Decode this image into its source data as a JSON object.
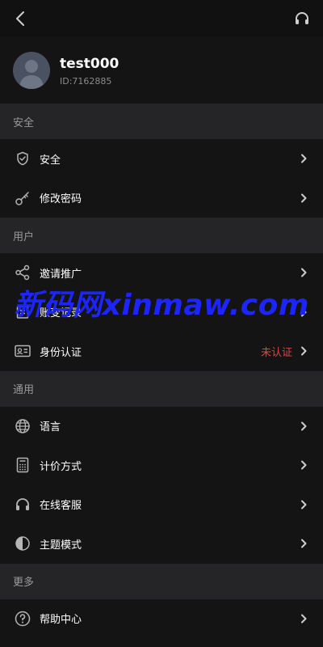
{
  "header": {
    "back_icon": "chevron-left-icon",
    "support_icon": "headset-icon"
  },
  "profile": {
    "username": "test000",
    "user_id": "ID:7162885"
  },
  "sections": {
    "security": {
      "title": "安全",
      "items": [
        {
          "label": "安全",
          "icon": "shield-check-icon"
        },
        {
          "label": "修改密码",
          "icon": "key-icon"
        }
      ]
    },
    "user": {
      "title": "用户",
      "items": [
        {
          "label": "邀请推广",
          "icon": "share-icon"
        },
        {
          "label": "账变记录",
          "icon": "document-icon"
        },
        {
          "label": "身份认证",
          "icon": "id-card-icon",
          "status": "未认证"
        }
      ]
    },
    "general": {
      "title": "通用",
      "items": [
        {
          "label": "语言",
          "icon": "globe-icon"
        },
        {
          "label": "计价方式",
          "icon": "calculator-icon"
        },
        {
          "label": "在线客服",
          "icon": "headset-icon"
        },
        {
          "label": "主题模式",
          "icon": "contrast-icon"
        }
      ]
    },
    "more": {
      "title": "更多",
      "items": [
        {
          "label": "帮助中心",
          "icon": "help-circle-icon"
        }
      ]
    }
  },
  "watermark": "新码网xinmaw.com",
  "colors": {
    "background": "#141414",
    "section_header": "#252527",
    "status_warning": "#e0453d",
    "watermark": "#1c24ff"
  }
}
